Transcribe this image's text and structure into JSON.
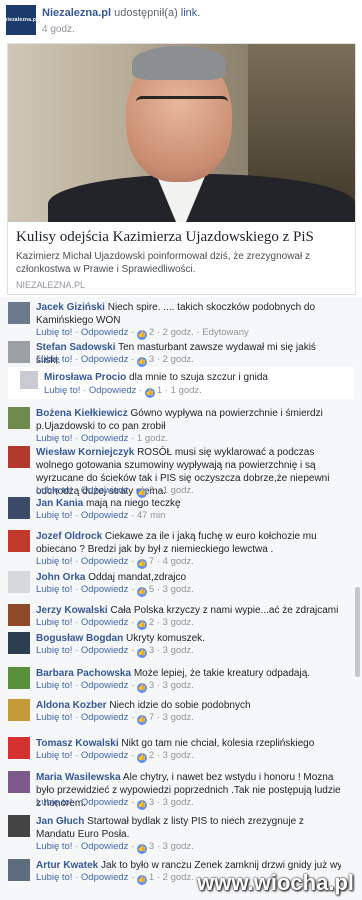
{
  "post": {
    "page_logo": "niezalezna.pl",
    "page_name": "Niezalezna.pl",
    "action": "udostępnił(a)",
    "link_word": "link.",
    "time": "4 godz."
  },
  "link": {
    "title": "Kulisy odejścia Kazimierza Ujazdowskiego z PiS",
    "description": "Kazimierz Michał Ujazdowski poinformował dziś, że zrezygnował z członkostwa w Prawie i Sprawiedliwości.",
    "domain": "NIEZALEZNA.PL"
  },
  "comments": [
    {
      "author": "Jacek Giziński",
      "text": "Niech spire. .... takich skoczków podobnych do Kamińskiego WON",
      "meta": {
        "like": "Lubię to!",
        "reply": "Odpowiedz",
        "count": "2",
        "time": "2 godz.",
        "extra": "Edytowany"
      },
      "avatar_color": "#6b7a8c"
    },
    {
      "author": "Stefan Sadowski",
      "text": "Ten masturbant zawsze wydawał mi się jakiś śliski.",
      "meta": {
        "like": "Lubię to!",
        "reply": "Odpowiedz",
        "count": "3",
        "time": "2 godz."
      },
      "avatar_color": "#9aa0a6"
    },
    {
      "author": "Mirosława Procio",
      "text": "dla mnie to szuja szczur i gnida",
      "meta": {
        "like": "Lubię to!",
        "reply": "Odpowiedz",
        "count": "1",
        "time": "1 godz."
      },
      "avatar_color": "#c9cbd0"
    },
    {
      "author": "Bożena Kiełkiewicz",
      "text": "Gówno wypływa na powierzchnie i śmierdzi p.Ujazdowski to co pan zrobił",
      "meta": {
        "like": "Lubię to!",
        "reply": "Odpowiedz",
        "time": "1 godz."
      },
      "avatar_color": "#6e8a4e"
    },
    {
      "author": "Wiesław Korniejczyk",
      "text": "ROSÓŁ musi się wyklarować a podczas wolnego gotowania szumowiny wypływają na powierzchnię i są wyrzucane do ścieków tak i PIS się oczyszcza dobrze,że niepewni odchodzą dużej straty niema.",
      "meta": {
        "like": "Lubię to!",
        "reply": "Odpowiedz",
        "count": "3",
        "time": "1 godz."
      },
      "avatar_color": "#b03a2e"
    },
    {
      "author": "Jan Kania",
      "text": "mają na niego teczkę",
      "meta": {
        "like": "Lubię to!",
        "reply": "Odpowiedz",
        "time": "47 min"
      },
      "avatar_color": "#3b4a66"
    },
    {
      "author": "Jozef Oldrock",
      "text": "Ciekawe za ile i jaką fuchę w euro kołchozie mu obiecano ? Bredzi jak by był z niemieckiego lewctwa .",
      "meta": {
        "like": "Lubię to!",
        "reply": "Odpowiedz",
        "count": "7",
        "time": "4 godz."
      },
      "avatar_color": "#c0392b"
    },
    {
      "author": "John Orka",
      "text": "Oddaj mandat,zdrajco",
      "meta": {
        "like": "Lubię to!",
        "reply": "Odpowiedz",
        "count": "5",
        "time": "3 godz."
      },
      "avatar_color": "#d5d8dc"
    },
    {
      "author": "Jerzy Kowalski",
      "text": "Cała Polska krzyczy z nami wypie...ać że zdrajcami",
      "meta": {
        "like": "Lubię to!",
        "reply": "Odpowiedz",
        "count": "2",
        "time": "3 godz."
      },
      "avatar_color": "#8e4a2a"
    },
    {
      "author": "Bogusław Bogdan",
      "text": "Ukryty komuszek.",
      "meta": {
        "like": "Lubię to!",
        "reply": "Odpowiedz",
        "count": "3",
        "time": "3 godz."
      },
      "avatar_color": "#2c3e50"
    },
    {
      "author": "Barbara Pachowska",
      "text": "Może lepiej, że takie kreatury odpadają.",
      "meta": {
        "like": "Lubię to!",
        "reply": "Odpowiedz",
        "count": "3",
        "time": "3 godz."
      },
      "avatar_color": "#5a8f3c"
    },
    {
      "author": "Aldona Kozber",
      "text": "Niech idzie do sobie podobnych",
      "meta": {
        "like": "Lubię to!",
        "reply": "Odpowiedz",
        "count": "7",
        "time": "3 godz."
      },
      "avatar_color": "#c49a3a"
    },
    {
      "author": "Tomasz Kowalski",
      "text": "Nikt go tam nie chciał, kolesia rzeplińskiego",
      "meta": {
        "like": "Lubię to!",
        "reply": "Odpowiedz",
        "count": "2",
        "time": "3 godz."
      },
      "avatar_color": "#d63031"
    },
    {
      "author": "Maria Wasilewska",
      "text": "Ale chytry, i nawet bez wstydu i honoru ! Mozna było przewidzieć z wypowiedzi poprzednich .Tak nie postępują ludzie z honorem.",
      "meta": {
        "like": "Lubię to!",
        "reply": "Odpowiedz",
        "count": "3",
        "time": "3 godz."
      },
      "avatar_color": "#7d5a8c"
    },
    {
      "author": "Jan Głuch",
      "text": "Startował bydlak z listy PIS to niech zrezygnuje z Mandatu Euro Posła.",
      "meta": {
        "like": "Lubię to!",
        "reply": "Odpowiedz",
        "count": "3",
        "time": "3 godz."
      },
      "avatar_color": "#444"
    },
    {
      "author": "Artur Kwatek",
      "text": "Jak to było w ranczu Zenek zamknij drzwi gnidy już wyszły!!!!!!!!",
      "meta": {
        "like": "Lubię to!",
        "reply": "Odpowiedz",
        "count": "1",
        "time": "2 godz."
      },
      "avatar_color": "#5d6d7e"
    }
  ],
  "watermark": "www.wiocha.pl"
}
